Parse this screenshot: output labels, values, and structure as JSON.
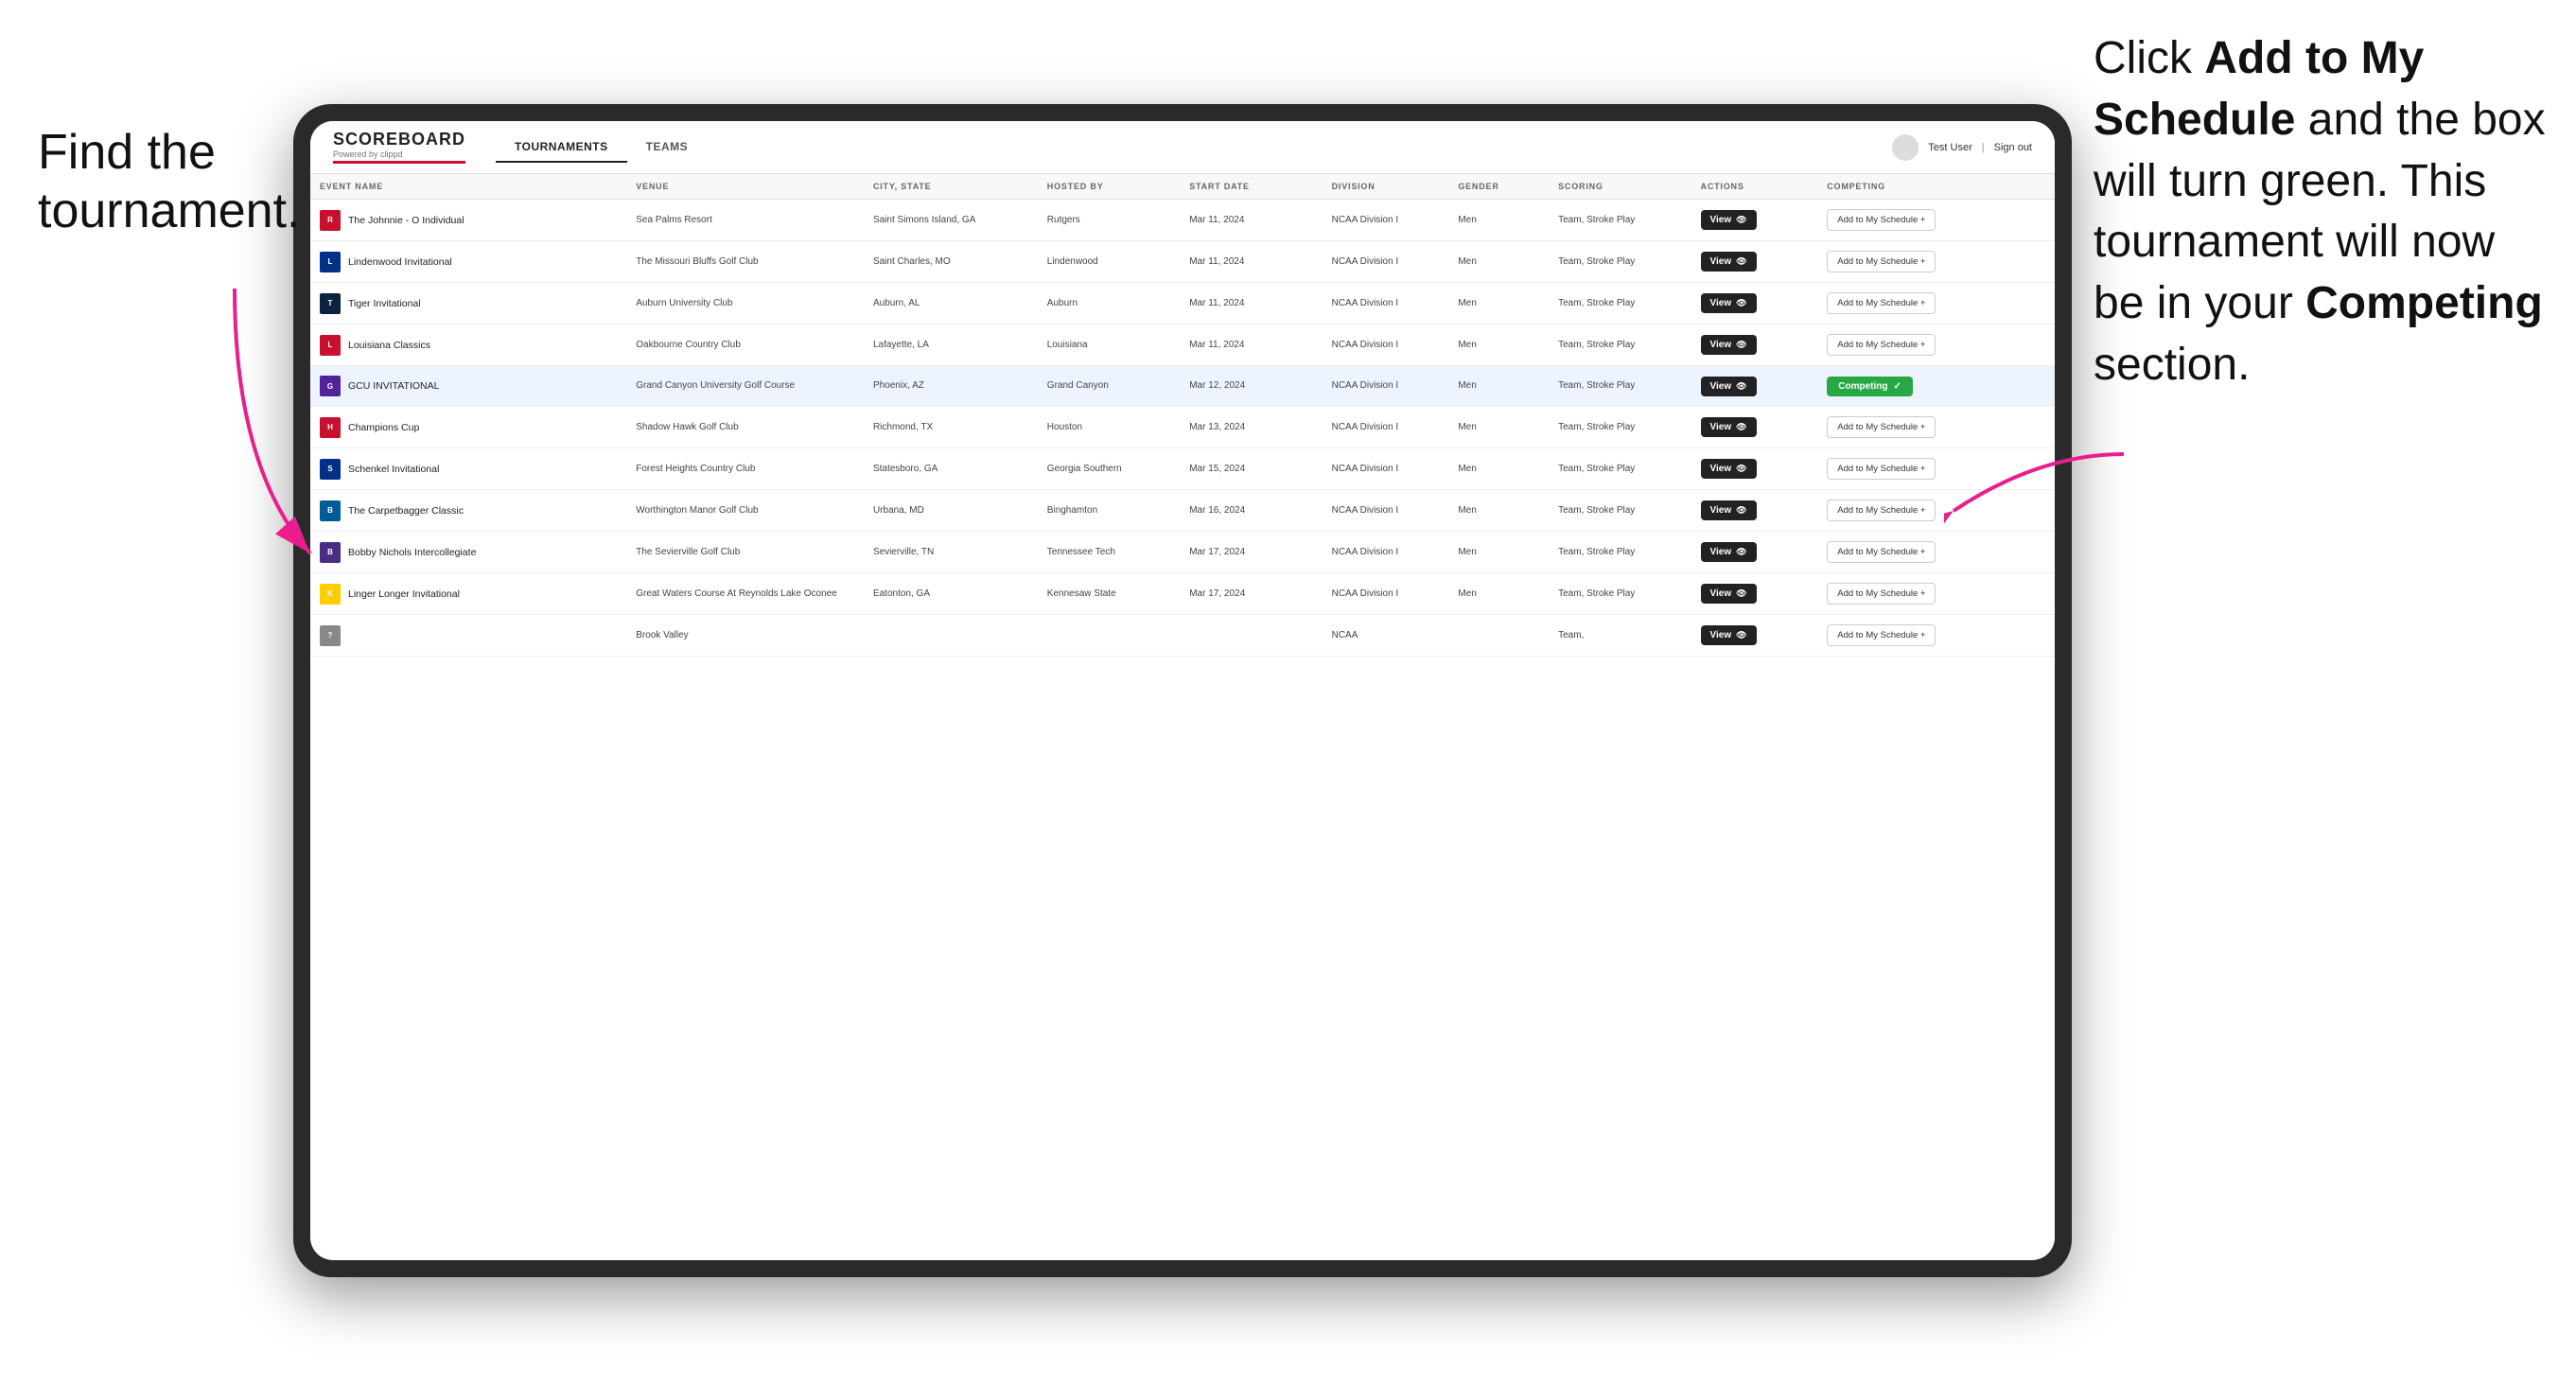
{
  "annotations": {
    "left_title": "Find the",
    "left_subtitle": "tournament.",
    "right_text_1": "Click ",
    "right_bold_1": "Add to My Schedule",
    "right_text_2": " and the box will turn green. This tournament will now be in your ",
    "right_bold_2": "Competing",
    "right_text_3": " section."
  },
  "header": {
    "logo": "SCOREBOARD",
    "logo_sub": "Powered by clippd",
    "nav_tabs": [
      "TOURNAMENTS",
      "TEAMS"
    ],
    "active_tab": "TOURNAMENTS",
    "user_name": "Test User",
    "sign_out": "Sign out"
  },
  "table": {
    "columns": [
      "EVENT NAME",
      "VENUE",
      "CITY, STATE",
      "HOSTED BY",
      "START DATE",
      "DIVISION",
      "GENDER",
      "SCORING",
      "ACTIONS",
      "COMPETING"
    ],
    "rows": [
      {
        "logo_color": "#c8102e",
        "logo_letter": "R",
        "event_name": "The Johnnie - O Individual",
        "venue": "Sea Palms Resort",
        "city": "Saint Simons Island, GA",
        "hosted_by": "Rutgers",
        "start_date": "Mar 11, 2024",
        "division": "NCAA Division I",
        "gender": "Men",
        "scoring": "Team, Stroke Play",
        "action": "View",
        "competing_status": "add",
        "competing_label": "Add to My Schedule +"
      },
      {
        "logo_color": "#003087",
        "logo_letter": "L",
        "event_name": "Lindenwood Invitational",
        "venue": "The Missouri Bluffs Golf Club",
        "city": "Saint Charles, MO",
        "hosted_by": "Lindenwood",
        "start_date": "Mar 11, 2024",
        "division": "NCAA Division I",
        "gender": "Men",
        "scoring": "Team, Stroke Play",
        "action": "View",
        "competing_status": "add",
        "competing_label": "Add to My Schedule +"
      },
      {
        "logo_color": "#0c2340",
        "logo_letter": "T",
        "event_name": "Tiger Invitational",
        "venue": "Auburn University Club",
        "city": "Auburn, AL",
        "hosted_by": "Auburn",
        "start_date": "Mar 11, 2024",
        "division": "NCAA Division I",
        "gender": "Men",
        "scoring": "Team, Stroke Play",
        "action": "View",
        "competing_status": "add",
        "competing_label": "Add to My Schedule +"
      },
      {
        "logo_color": "#c8102e",
        "logo_letter": "L",
        "event_name": "Louisiana Classics",
        "venue": "Oakbourne Country Club",
        "city": "Lafayette, LA",
        "hosted_by": "Louisiana",
        "start_date": "Mar 11, 2024",
        "division": "NCAA Division I",
        "gender": "Men",
        "scoring": "Team, Stroke Play",
        "action": "View",
        "competing_status": "add",
        "competing_label": "Add to My Schedule +"
      },
      {
        "logo_color": "#522398",
        "logo_letter": "G",
        "event_name": "GCU INVITATIONAL",
        "venue": "Grand Canyon University Golf Course",
        "city": "Phoenix, AZ",
        "hosted_by": "Grand Canyon",
        "start_date": "Mar 12, 2024",
        "division": "NCAA Division I",
        "gender": "Men",
        "scoring": "Team, Stroke Play",
        "action": "View",
        "competing_status": "competing",
        "competing_label": "Competing ✓",
        "highlighted": true
      },
      {
        "logo_color": "#c8102e",
        "logo_letter": "H",
        "event_name": "Champions Cup",
        "venue": "Shadow Hawk Golf Club",
        "city": "Richmond, TX",
        "hosted_by": "Houston",
        "start_date": "Mar 13, 2024",
        "division": "NCAA Division I",
        "gender": "Men",
        "scoring": "Team, Stroke Play",
        "action": "View",
        "competing_status": "add",
        "competing_label": "Add to My Schedule +"
      },
      {
        "logo_color": "#003087",
        "logo_letter": "S",
        "event_name": "Schenkel Invitational",
        "venue": "Forest Heights Country Club",
        "city": "Statesboro, GA",
        "hosted_by": "Georgia Southern",
        "start_date": "Mar 15, 2024",
        "division": "NCAA Division I",
        "gender": "Men",
        "scoring": "Team, Stroke Play",
        "action": "View",
        "competing_status": "add",
        "competing_label": "Add to My Schedule +"
      },
      {
        "logo_color": "#005B99",
        "logo_letter": "B",
        "event_name": "The Carpetbagger Classic",
        "venue": "Worthington Manor Golf Club",
        "city": "Urbana, MD",
        "hosted_by": "Binghamton",
        "start_date": "Mar 16, 2024",
        "division": "NCAA Division I",
        "gender": "Men",
        "scoring": "Team, Stroke Play",
        "action": "View",
        "competing_status": "add",
        "competing_label": "Add to My Schedule +"
      },
      {
        "logo_color": "#4B2E83",
        "logo_letter": "B",
        "event_name": "Bobby Nichols Intercollegiate",
        "venue": "The Sevierville Golf Club",
        "city": "Sevierville, TN",
        "hosted_by": "Tennessee Tech",
        "start_date": "Mar 17, 2024",
        "division": "NCAA Division I",
        "gender": "Men",
        "scoring": "Team, Stroke Play",
        "action": "View",
        "competing_status": "add",
        "competing_label": "Add to My Schedule +"
      },
      {
        "logo_color": "#FFCC00",
        "logo_letter": "K",
        "event_name": "Linger Longer Invitational",
        "venue": "Great Waters Course At Reynolds Lake Oconee",
        "city": "Eatonton, GA",
        "hosted_by": "Kennesaw State",
        "start_date": "Mar 17, 2024",
        "division": "NCAA Division I",
        "gender": "Men",
        "scoring": "Team, Stroke Play",
        "action": "View",
        "competing_status": "add",
        "competing_label": "Add to My Schedule +"
      },
      {
        "logo_color": "#888",
        "logo_letter": "?",
        "event_name": "",
        "venue": "Brook Valley",
        "city": "",
        "hosted_by": "",
        "start_date": "",
        "division": "NCAA",
        "gender": "",
        "scoring": "Team,",
        "action": "View",
        "competing_status": "add",
        "competing_label": "Add to My Schedule +"
      }
    ]
  }
}
